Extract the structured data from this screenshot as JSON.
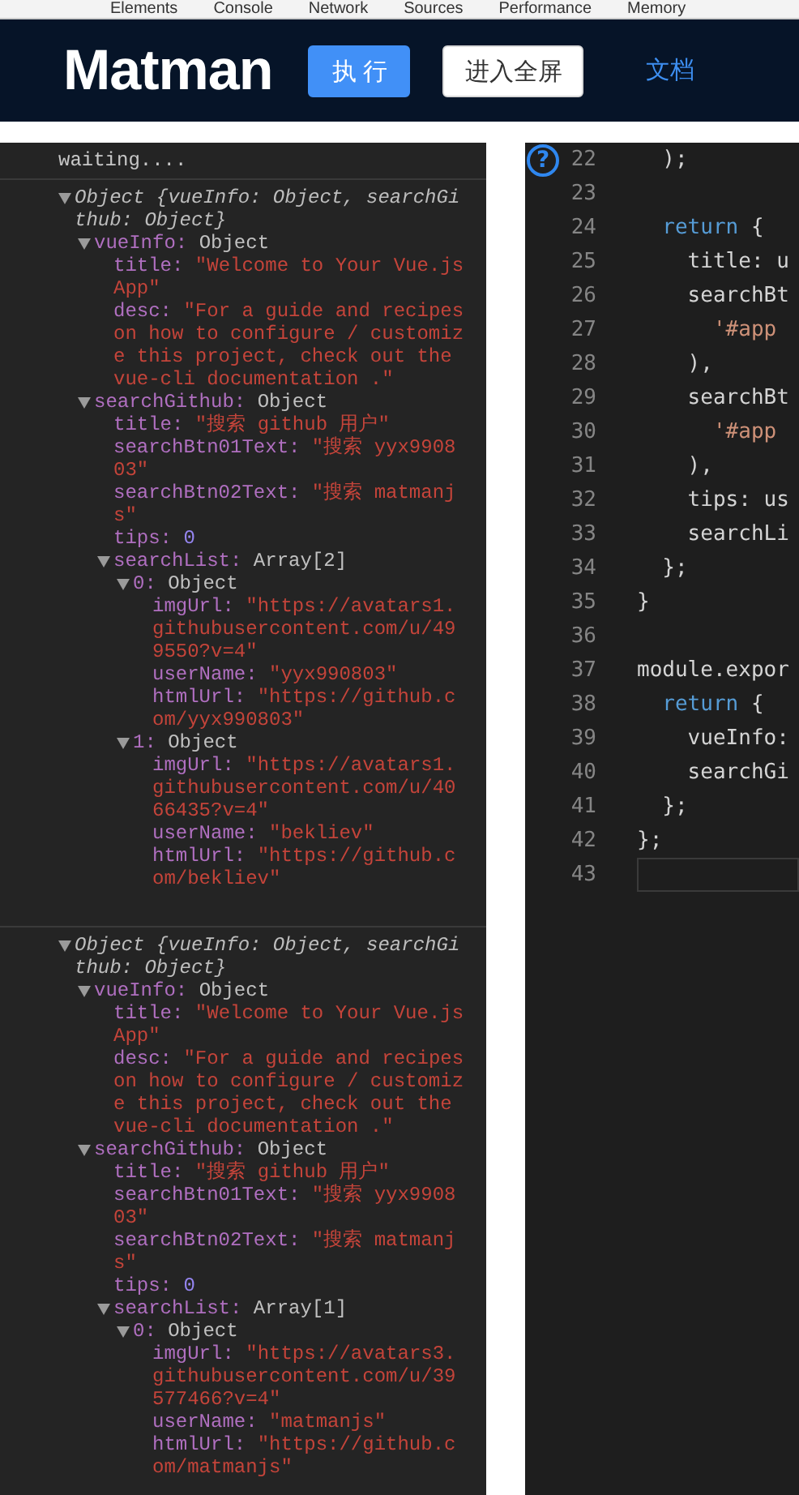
{
  "devtools_tabs": [
    "Elements",
    "Console",
    "Network",
    "Sources",
    "Performance",
    "Memory"
  ],
  "header": {
    "logo": "Matman",
    "buttons": [
      {
        "label": "执行",
        "kind": "primary"
      },
      {
        "label": "进入全屏",
        "kind": "default"
      }
    ],
    "link": "文档"
  },
  "console": {
    "entries": [
      {
        "kind": "text",
        "text": "waiting...."
      },
      {
        "kind": "tree",
        "root": {
          "kind": "summary",
          "summary": "Object {vueInfo: Object, searchGithub: Object}",
          "expanded": true,
          "children": [
            {
              "key": "vueInfo:",
              "value": "Object",
              "kind": "object",
              "expanded": true,
              "children": [
                {
                  "key": "title:",
                  "value": "\"Welcome to Your Vue.js App\"",
                  "kind": "string"
                },
                {
                  "key": "desc:",
                  "value": "\"For a guide and recipes on how to configure / customize this project, check out the  vue-cli documentation .\"",
                  "kind": "string"
                }
              ]
            },
            {
              "key": "searchGithub:",
              "value": "Object",
              "kind": "object",
              "expanded": true,
              "children": [
                {
                  "key": "title:",
                  "value": "\"搜索 github 用户\"",
                  "kind": "string"
                },
                {
                  "key": "searchBtn01Text:",
                  "value": "\"搜索 yyx990803\"",
                  "kind": "string"
                },
                {
                  "key": "searchBtn02Text:",
                  "value": "\"搜索 matmanjs\"",
                  "kind": "string"
                },
                {
                  "key": "tips:",
                  "value": "0",
                  "kind": "number"
                },
                {
                  "key": "searchList:",
                  "value": "Array[2]",
                  "kind": "object",
                  "expanded": true,
                  "children": [
                    {
                      "key": "0:",
                      "value": "Object",
                      "kind": "object",
                      "expanded": true,
                      "children": [
                        {
                          "key": "imgUrl:",
                          "value": "\"https://avatars1.githubusercontent.com/u/499550?v=4\"",
                          "kind": "string"
                        },
                        {
                          "key": "userName:",
                          "value": "\"yyx990803\"",
                          "kind": "string"
                        },
                        {
                          "key": "htmlUrl:",
                          "value": "\"https://github.com/yyx990803\"",
                          "kind": "string"
                        }
                      ]
                    },
                    {
                      "key": "1:",
                      "value": "Object",
                      "kind": "object",
                      "expanded": true,
                      "children": [
                        {
                          "key": "imgUrl:",
                          "value": "\"https://avatars1.githubusercontent.com/u/4066435?v=4\"",
                          "kind": "string"
                        },
                        {
                          "key": "userName:",
                          "value": "\"bekliev\"",
                          "kind": "string"
                        },
                        {
                          "key": "htmlUrl:",
                          "value": "\"https://github.com/bekliev\"",
                          "kind": "string"
                        }
                      ]
                    }
                  ]
                }
              ]
            }
          ]
        }
      },
      {
        "kind": "tree",
        "root": {
          "kind": "summary",
          "summary": "Object {vueInfo: Object, searchGithub: Object}",
          "expanded": true,
          "children": [
            {
              "key": "vueInfo:",
              "value": "Object",
              "kind": "object",
              "expanded": true,
              "children": [
                {
                  "key": "title:",
                  "value": "\"Welcome to Your Vue.js App\"",
                  "kind": "string"
                },
                {
                  "key": "desc:",
                  "value": "\"For a guide and recipes on how to configure / customize this project, check out the  vue-cli documentation .\"",
                  "kind": "string"
                }
              ]
            },
            {
              "key": "searchGithub:",
              "value": "Object",
              "kind": "object",
              "expanded": true,
              "children": [
                {
                  "key": "title:",
                  "value": "\"搜索 github 用户\"",
                  "kind": "string"
                },
                {
                  "key": "searchBtn01Text:",
                  "value": "\"搜索 yyx990803\"",
                  "kind": "string"
                },
                {
                  "key": "searchBtn02Text:",
                  "value": "\"搜索 matmanjs\"",
                  "kind": "string"
                },
                {
                  "key": "tips:",
                  "value": "0",
                  "kind": "number"
                },
                {
                  "key": "searchList:",
                  "value": "Array[1]",
                  "kind": "object",
                  "expanded": true,
                  "children": [
                    {
                      "key": "0:",
                      "value": "Object",
                      "kind": "object",
                      "expanded": true,
                      "children": [
                        {
                          "key": "imgUrl:",
                          "value": "\"https://avatars3.githubusercontent.com/u/39577466?v=4\"",
                          "kind": "string"
                        },
                        {
                          "key": "userName:",
                          "value": "\"matmanjs\"",
                          "kind": "string"
                        },
                        {
                          "key": "htmlUrl:",
                          "value": "\"https://github.com/matmanjs\"",
                          "kind": "string"
                        }
                      ]
                    }
                  ]
                }
              ]
            }
          ]
        }
      }
    ]
  },
  "editor": {
    "help_badge": "?",
    "lines": [
      {
        "number": "22",
        "tokens": [
          {
            "kind": "plain",
            "text": "  );"
          }
        ]
      },
      {
        "number": "23"
      },
      {
        "number": "24",
        "tokens": [
          {
            "kind": "keyword",
            "text": "  return"
          },
          {
            "kind": "plain",
            "text": " {"
          }
        ]
      },
      {
        "number": "25",
        "tokens": [
          {
            "kind": "plain",
            "text": "    title: u"
          }
        ]
      },
      {
        "number": "26",
        "tokens": [
          {
            "kind": "plain",
            "text": "    searchBt"
          }
        ]
      },
      {
        "number": "27",
        "tokens": [
          {
            "kind": "string",
            "text": "      '#app"
          }
        ]
      },
      {
        "number": "28",
        "tokens": [
          {
            "kind": "plain",
            "text": "    ),"
          }
        ]
      },
      {
        "number": "29",
        "tokens": [
          {
            "kind": "plain",
            "text": "    searchBt"
          }
        ]
      },
      {
        "number": "30",
        "tokens": [
          {
            "kind": "string",
            "text": "      '#app"
          }
        ]
      },
      {
        "number": "31",
        "tokens": [
          {
            "kind": "plain",
            "text": "    ),"
          }
        ]
      },
      {
        "number": "32",
        "tokens": [
          {
            "kind": "plain",
            "text": "    tips: us"
          }
        ]
      },
      {
        "number": "33",
        "tokens": [
          {
            "kind": "plain",
            "text": "    searchLi"
          }
        ]
      },
      {
        "number": "34",
        "tokens": [
          {
            "kind": "plain",
            "text": "  };"
          }
        ]
      },
      {
        "number": "35",
        "tokens": [
          {
            "kind": "plain",
            "text": "}"
          }
        ]
      },
      {
        "number": "36"
      },
      {
        "number": "37",
        "tokens": [
          {
            "kind": "plain",
            "text": "module.expor"
          }
        ]
      },
      {
        "number": "38",
        "tokens": [
          {
            "kind": "keyword",
            "text": "  return"
          },
          {
            "kind": "plain",
            "text": " {"
          }
        ]
      },
      {
        "number": "39",
        "tokens": [
          {
            "kind": "plain",
            "text": "    vueInfo:"
          }
        ]
      },
      {
        "number": "40",
        "tokens": [
          {
            "kind": "plain",
            "text": "    searchGi"
          }
        ]
      },
      {
        "number": "41",
        "tokens": [
          {
            "kind": "plain",
            "text": "  };"
          }
        ]
      },
      {
        "number": "42",
        "tokens": [
          {
            "kind": "plain",
            "text": "};"
          }
        ]
      },
      {
        "number": "43",
        "current": true
      }
    ]
  }
}
